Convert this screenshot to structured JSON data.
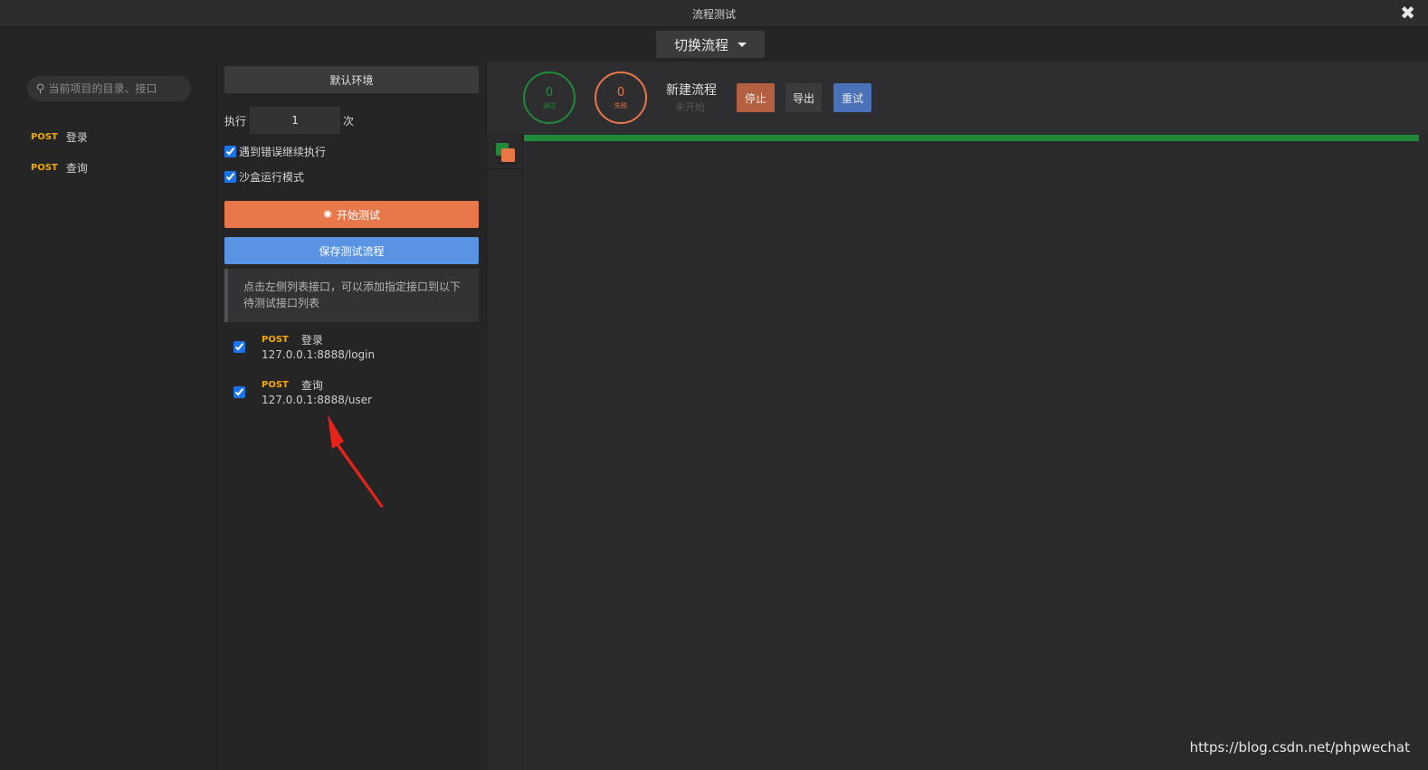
{
  "window": {
    "title": "流程测试",
    "close_symbol": "✖"
  },
  "switch_flow": {
    "label": "切换流程"
  },
  "sidebar": {
    "search_placeholder": "当前项目的目录、接口",
    "items": [
      {
        "method": "POST",
        "name": "登录"
      },
      {
        "method": "POST",
        "name": "查询"
      }
    ]
  },
  "config": {
    "environment": "默认环境",
    "exec_prefix": "执行",
    "exec_count": "1",
    "exec_suffix": "次",
    "continue_on_error": "遇到错误继续执行",
    "sandbox_mode": "沙盒运行模式",
    "start_label": "开始测试",
    "save_label": "保存测试流程",
    "hint_line1": "点击左侧列表接口，可以添加指定接口到以下",
    "hint_line2": "待测试接口列表"
  },
  "flow_items": [
    {
      "method": "POST",
      "name": "登录",
      "url": "127.0.0.1:8888/login"
    },
    {
      "method": "POST",
      "name": "查询",
      "url": "127.0.0.1:8888/user"
    }
  ],
  "stats": {
    "pass_count": "0",
    "pass_label": "通过",
    "fail_count": "0",
    "fail_label": "失败",
    "flow_name": "新建流程",
    "flow_status": "未开始"
  },
  "actions": {
    "stop": "停止",
    "export": "导出",
    "retry": "重试"
  },
  "colors": {
    "pass": "#1f8a39",
    "fail": "#e8774a",
    "method": "#f2a900",
    "save": "#5b93e3"
  },
  "watermark": "https://blog.csdn.net/phpwechat"
}
